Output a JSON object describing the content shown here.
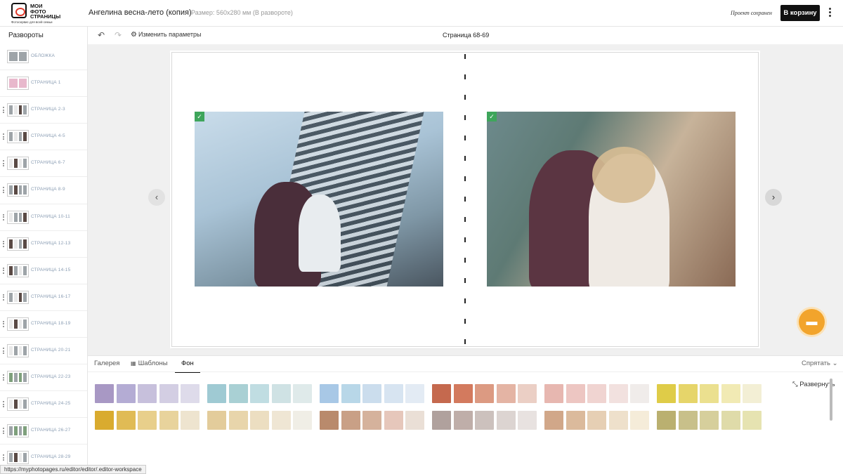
{
  "header": {
    "logo_text": "МОИ\nФОТО\nСТРАНИЦЫ",
    "logo_tagline": "Фотосервис для всей семьи",
    "project_title": "Ангелина весна-лето (копия)",
    "size_text": "Размер: 560x280 мм (В развороте)",
    "saved_text": "Проект сохранен",
    "cart_label": "В корзину"
  },
  "sidebar": {
    "title": "Развороты",
    "items": [
      {
        "label": "ОБЛОЖКА",
        "thumb": [
          "g",
          "g"
        ]
      },
      {
        "label": "СТРАНИЦА 1",
        "thumb": [
          "pk",
          "pk"
        ]
      },
      {
        "label": "СТРАНИЦА 2-3",
        "thumb": [
          "g",
          "w",
          "dk",
          "g"
        ]
      },
      {
        "label": "СТРАНИЦА 4-5",
        "thumb": [
          "g",
          "w",
          "g",
          "dk"
        ]
      },
      {
        "label": "СТРАНИЦА 6-7",
        "thumb": [
          "w",
          "dk",
          "w",
          "g"
        ]
      },
      {
        "label": "СТРАНИЦА 8-9",
        "thumb": [
          "g",
          "dk",
          "g",
          "g"
        ]
      },
      {
        "label": "СТРАНИЦА 10-11",
        "thumb": [
          "w",
          "g",
          "g",
          "dk"
        ]
      },
      {
        "label": "СТРАНИЦА 12-13",
        "thumb": [
          "dk",
          "w",
          "g",
          "dk"
        ]
      },
      {
        "label": "СТРАНИЦА 14-15",
        "thumb": [
          "dk",
          "g",
          "w",
          "g"
        ]
      },
      {
        "label": "СТРАНИЦА 16-17",
        "thumb": [
          "g",
          "w",
          "dk",
          "g"
        ]
      },
      {
        "label": "СТРАНИЦА 18-19",
        "thumb": [
          "w",
          "dk",
          "w",
          "g"
        ]
      },
      {
        "label": "СТРАНИЦА 20-21",
        "thumb": [
          "w",
          "g",
          "w",
          "g"
        ]
      },
      {
        "label": "СТРАНИЦА 22-23",
        "thumb": [
          "gn",
          "g",
          "gn",
          "g"
        ]
      },
      {
        "label": "СТРАНИЦА 24-25",
        "thumb": [
          "w",
          "dk",
          "w",
          "g"
        ]
      },
      {
        "label": "СТРАНИЦА 26-27",
        "thumb": [
          "g",
          "gn",
          "g",
          "gn"
        ]
      },
      {
        "label": "СТРАНИЦА 28-29",
        "thumb": [
          "g",
          "dk",
          "w",
          "g"
        ]
      }
    ]
  },
  "toolbar": {
    "change_params": "Изменить параметры",
    "page_indicator": "Страница 68-69"
  },
  "panel": {
    "tabs": [
      "Галерея",
      "Шаблоны",
      "Фон"
    ],
    "active_tab": "Фон",
    "hide_label": "Спрятать",
    "expand_label": "Развернуть",
    "swatch_groups": [
      {
        "row1": [
          "#a898c4",
          "#b4acd4",
          "#c7c0dc",
          "#d3cee3",
          "#dedbea"
        ],
        "row2": [
          "#d9ab2f",
          "#e0bb55",
          "#e8cf8b",
          "#e8d39c",
          "#eee4cf"
        ]
      },
      {
        "row1": [
          "#9fcad3",
          "#a9d0d4",
          "#c0dde2",
          "#cfe2e4",
          "#dfeaea"
        ],
        "row2": [
          "#e3cc9b",
          "#e8d5ab",
          "#ecdec1",
          "#efe6d4",
          "#f0eee6"
        ]
      },
      {
        "row1": [
          "#a8c8e6",
          "#b8d7e8",
          "#cbdded",
          "#d7e4f1",
          "#e3ebf4"
        ],
        "row2": [
          "#b98a6c",
          "#c9a086",
          "#d5b29c",
          "#e6c7bb",
          "#eadfd6"
        ]
      },
      {
        "row1": [
          "#c5694e",
          "#d37a5e",
          "#dc9a82",
          "#e4b4a4",
          "#ebcfc5"
        ],
        "row2": [
          "#b0a19d",
          "#bfaea9",
          "#ccc1bd",
          "#dcd4d1",
          "#e8e2e0"
        ]
      },
      {
        "row1": [
          "#e7b7b0",
          "#edc6c2",
          "#f0d4d1",
          "#f2e1df",
          "#f0ecea"
        ],
        "row2": [
          "#d1a789",
          "#dbba9c",
          "#e6cfb4",
          "#eee0cb",
          "#f5ecd9"
        ]
      },
      {
        "row1": [
          "#dfcc48",
          "#e6d56a",
          "#ebe08f",
          "#f1eab4",
          "#f3efd5"
        ],
        "row2": [
          "#bab070",
          "#c8c08a",
          "#d6cf9c",
          "#dfdba9",
          "#e6e3b1"
        ]
      }
    ]
  },
  "status_url": "https://myphotopages.ru/editor/editor/.editor-workspace",
  "icons": {
    "undo": "undo-icon",
    "redo": "redo-icon",
    "settings": "gear-icon",
    "prev": "chevron-left-icon",
    "next": "chevron-right-icon",
    "chat": "chat-icon",
    "check": "check-icon",
    "templates": "template-icon",
    "hide": "chevron-down-icon",
    "expand": "expand-icon"
  },
  "colors": {
    "accent_dark": "#111111",
    "check_green": "#3ea55b",
    "chat_orange": "#f2a42c",
    "sidebar_label": "#8a9db3"
  }
}
